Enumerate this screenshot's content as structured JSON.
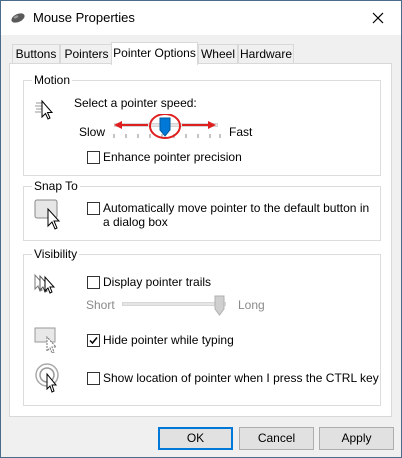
{
  "window": {
    "title": "Mouse Properties"
  },
  "tabs": [
    {
      "label": "Buttons"
    },
    {
      "label": "Pointers"
    },
    {
      "label": "Pointer Options",
      "active": true
    },
    {
      "label": "Wheel"
    },
    {
      "label": "Hardware"
    }
  ],
  "motion": {
    "title": "Motion",
    "speed_label": "Select a pointer speed:",
    "slow": "Slow",
    "fast": "Fast",
    "enhance_precision": "Enhance pointer precision",
    "enhance_checked": false
  },
  "snap_to": {
    "title": "Snap To",
    "auto_move": "Automatically move pointer to the default button in a dialog box",
    "auto_move_checked": false
  },
  "visibility": {
    "title": "Visibility",
    "trails": "Display pointer trails",
    "trails_checked": false,
    "short": "Short",
    "long": "Long",
    "hide_typing": "Hide pointer while typing",
    "hide_typing_checked": true,
    "show_location": "Show location of pointer when I press the CTRL key",
    "show_location_checked": false
  },
  "buttons": {
    "ok": "OK",
    "cancel": "Cancel",
    "apply": "Apply"
  },
  "colors": {
    "accent": "#0078d7",
    "annotation": "#e02020"
  }
}
